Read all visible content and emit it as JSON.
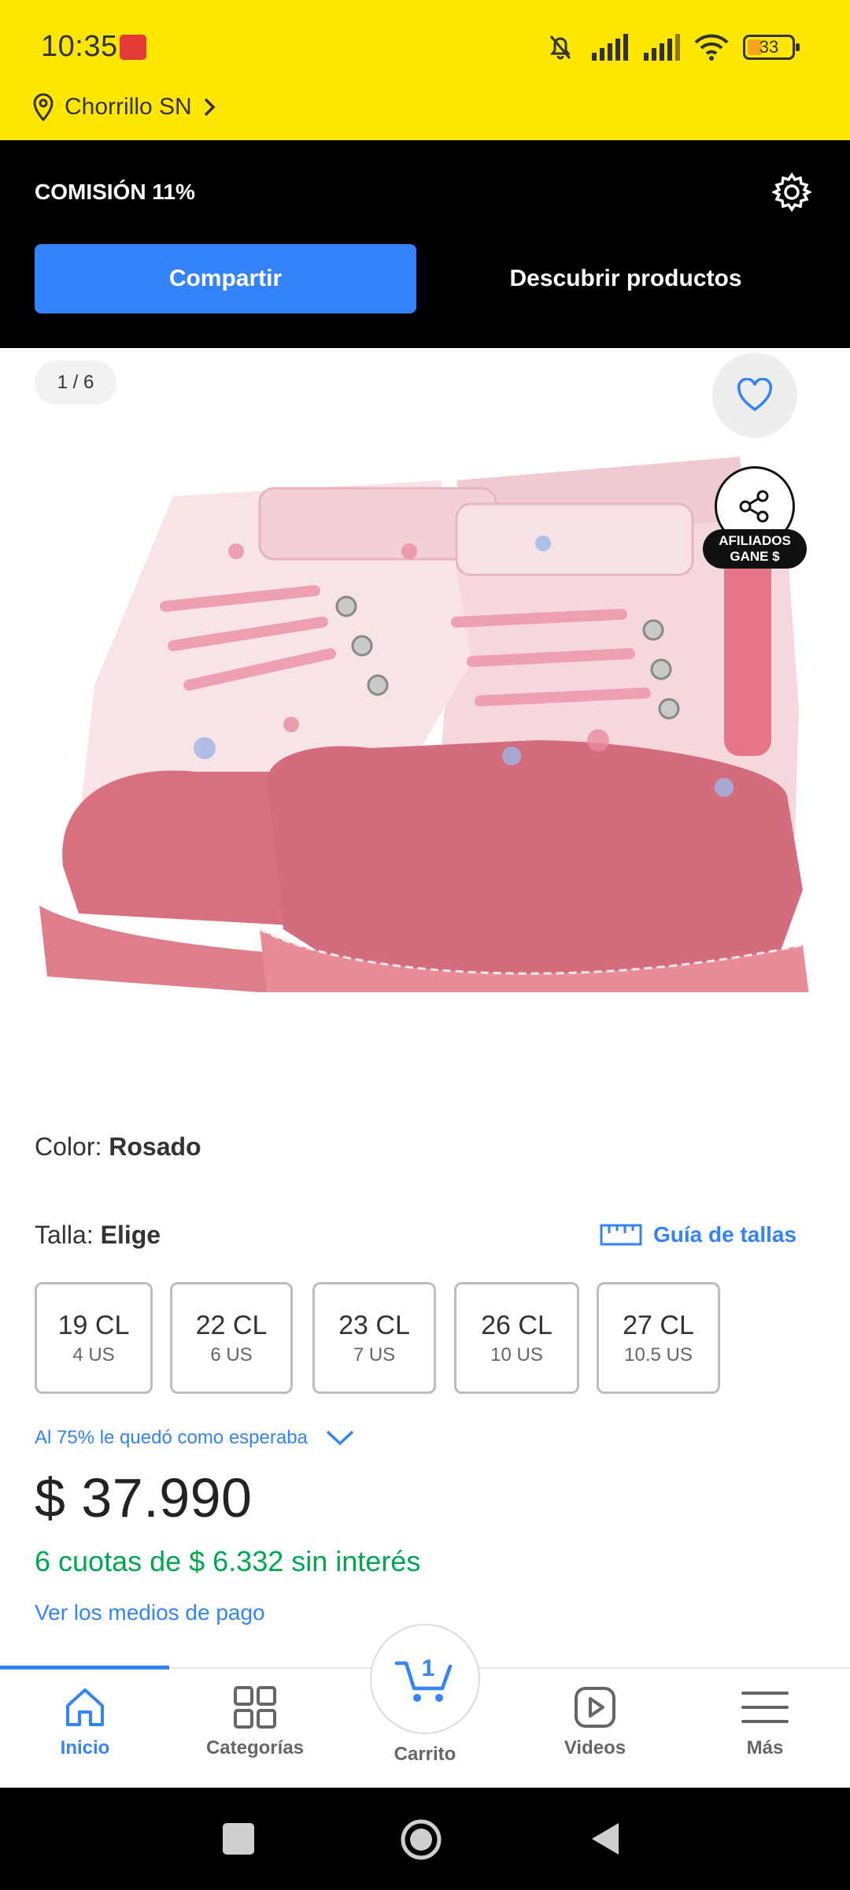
{
  "status_bar": {
    "time": "10:35",
    "battery": "33"
  },
  "location": {
    "label": "Chorrillo SN"
  },
  "affiliate_bar": {
    "commission": "COMISIÓN 11%",
    "share_button": "Compartir",
    "discover_button": "Descubrir productos"
  },
  "gallery": {
    "pager": "1 / 6",
    "affiliate_badge_line1": "AFILIADOS",
    "affiliate_badge_line2": "GANE $"
  },
  "product": {
    "color_label": "Color: ",
    "color_value": "Rosado",
    "size_label": "Talla: ",
    "size_value": "Elige",
    "size_guide": "Guía de tallas",
    "sizes": [
      {
        "cl": "19 CL",
        "us": "4 US"
      },
      {
        "cl": "22 CL",
        "us": "6 US"
      },
      {
        "cl": "23 CL",
        "us": "7 US"
      },
      {
        "cl": "26 CL",
        "us": "10 US"
      },
      {
        "cl": "27 CL",
        "us": "10.5 US"
      }
    ],
    "fit_text": "Al 75% le quedó como esperaba",
    "price": "$ 37.990",
    "installments": "6 cuotas de $ 6.332 sin interés",
    "payment_methods": "Ver los medios de pago"
  },
  "bottom_nav": {
    "items": [
      {
        "label": "Inicio"
      },
      {
        "label": "Categorías"
      },
      {
        "label": "Carrito",
        "badge": "1"
      },
      {
        "label": "Videos"
      },
      {
        "label": "Más"
      }
    ]
  },
  "colors": {
    "brand_yellow": "#FFE600",
    "accent_blue": "#3483FA",
    "success_green": "#00A650"
  }
}
